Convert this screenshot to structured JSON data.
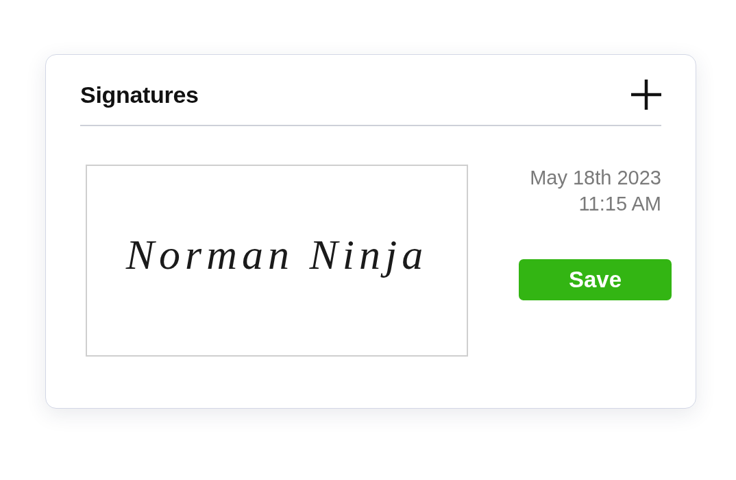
{
  "panel": {
    "title": "Signatures"
  },
  "signature": {
    "handwriting": "Norman Ninja",
    "date": "May 18th 2023",
    "time": "11:15 AM",
    "save_button": "Save"
  }
}
